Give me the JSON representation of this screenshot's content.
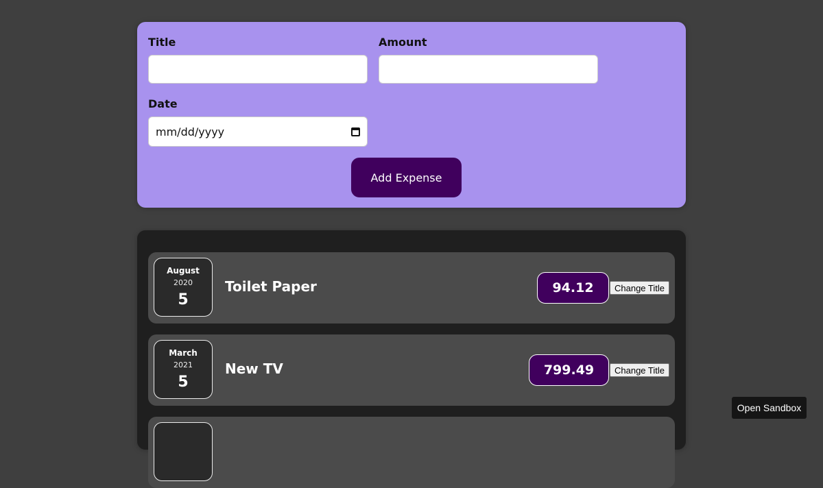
{
  "form": {
    "title_label": "Title",
    "title_value": "",
    "amount_label": "Amount",
    "amount_value": "",
    "date_label": "Date",
    "date_placeholder": "mm/dd/yyyy",
    "submit_label": "Add Expense"
  },
  "expenses": [
    {
      "month": "August",
      "year": "2020",
      "day": "5",
      "title": "Toilet Paper",
      "amount": "94.12",
      "action_label": "Change Title"
    },
    {
      "month": "March",
      "year": "2021",
      "day": "5",
      "title": "New TV",
      "amount": "799.49",
      "action_label": "Change Title"
    }
  ],
  "sandbox_label": "Open Sandbox",
  "colors": {
    "form_bg": "#a892ee",
    "accent": "#40005d",
    "page_bg": "#3f3f3f",
    "list_bg": "#1f1f1f",
    "row_bg": "#4b4b4b"
  }
}
